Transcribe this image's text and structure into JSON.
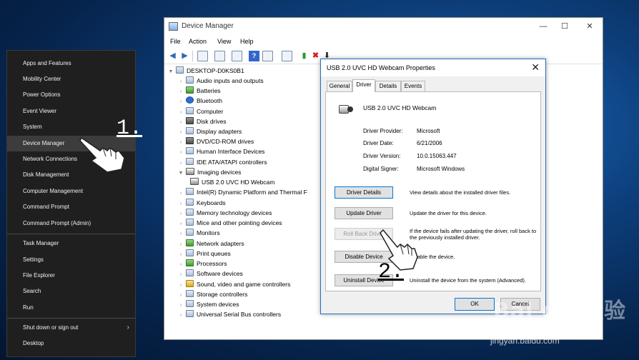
{
  "winx_menu": {
    "items": [
      {
        "label": "Apps and Features"
      },
      {
        "label": "Mobility Center"
      },
      {
        "label": "Power Options"
      },
      {
        "label": "Event Viewer"
      },
      {
        "label": "System"
      },
      {
        "label": "Device Manager"
      },
      {
        "label": "Network Connections"
      },
      {
        "label": "Disk Management"
      },
      {
        "label": "Computer Management"
      },
      {
        "label": "Command Prompt"
      },
      {
        "label": "Command Prompt (Admin)"
      },
      {
        "label": "Task Manager"
      },
      {
        "label": "Settings"
      },
      {
        "label": "File Explorer"
      },
      {
        "label": "Search"
      },
      {
        "label": "Run"
      },
      {
        "label": "Shut down or sign out"
      },
      {
        "label": "Desktop"
      }
    ],
    "chevron": "›"
  },
  "device_manager": {
    "title": "Device Manager",
    "caption": {
      "minimize": "—",
      "maximize": "☐",
      "close": "✕"
    },
    "menu": [
      "File",
      "Action",
      "View",
      "Help"
    ],
    "tree_root": "DESKTOP-D0KS0B1",
    "tree": [
      {
        "label": "Audio inputs and outputs",
        "icon": "speaker-icon"
      },
      {
        "label": "Batteries",
        "icon": "battery-icon"
      },
      {
        "label": "Bluetooth",
        "icon": "bluetooth-icon"
      },
      {
        "label": "Computer",
        "icon": "computer-icon"
      },
      {
        "label": "Disk drives",
        "icon": "disk-icon"
      },
      {
        "label": "Display adapters",
        "icon": "display-icon"
      },
      {
        "label": "DVD/CD-ROM drives",
        "icon": "dvd-icon"
      },
      {
        "label": "Human Interface Devices",
        "icon": "hid-icon"
      },
      {
        "label": "IDE ATA/ATAPI controllers",
        "icon": "ide-icon"
      },
      {
        "label": "Imaging devices",
        "icon": "camera-icon"
      },
      {
        "label": "USB 2.0 UVC HD Webcam",
        "icon": "webcam-icon"
      },
      {
        "label": "Intel(R) Dynamic Platform and Thermal F",
        "icon": "chip-icon"
      },
      {
        "label": "Keyboards",
        "icon": "keyboard-icon"
      },
      {
        "label": "Memory technology devices",
        "icon": "memory-icon"
      },
      {
        "label": "Mice and other pointing devices",
        "icon": "mouse-icon"
      },
      {
        "label": "Monitors",
        "icon": "monitor-icon"
      },
      {
        "label": "Network adapters",
        "icon": "network-icon"
      },
      {
        "label": "Print queues",
        "icon": "printer-icon"
      },
      {
        "label": "Processors",
        "icon": "processor-icon"
      },
      {
        "label": "Software devices",
        "icon": "software-icon"
      },
      {
        "label": "Sound, video and game controllers",
        "icon": "sound-icon"
      },
      {
        "label": "Storage controllers",
        "icon": "storage-icon"
      },
      {
        "label": "System devices",
        "icon": "system-icon"
      },
      {
        "label": "Universal Serial Bus controllers",
        "icon": "usb-icon"
      }
    ]
  },
  "dialog": {
    "title": "USB 2.0 UVC HD Webcam Properties",
    "close": "✕",
    "tabs": [
      "General",
      "Driver",
      "Details",
      "Events"
    ],
    "active_tab": "Driver",
    "device_name": "USB 2.0 UVC HD Webcam",
    "fields": [
      {
        "label": "Driver Provider:",
        "value": "Microsoft"
      },
      {
        "label": "Driver Date:",
        "value": "6/21/2006"
      },
      {
        "label": "Driver Version:",
        "value": "10.0.15063.447"
      },
      {
        "label": "Digital Signer:",
        "value": "Microsoft Windows"
      }
    ],
    "buttons": [
      {
        "label": "Driver Details",
        "desc": "View details about the installed driver files."
      },
      {
        "label": "Update Driver",
        "desc": "Update the driver for this device."
      },
      {
        "label": "Roll Back Driver",
        "desc": "If the device fails after updating the driver, roll back to the previously installed driver."
      },
      {
        "label": "Disable Device",
        "desc": "Disable the device."
      },
      {
        "label": "Uninstall Device",
        "desc": "Uninstall the device from the system (Advanced)."
      }
    ],
    "ok": "OK",
    "cancel": "Cancel"
  },
  "annotations": {
    "step1": "1.",
    "step2": "2."
  },
  "watermark": {
    "brand": "Bai du 经验",
    "url": "jingyan.baidu.com"
  }
}
